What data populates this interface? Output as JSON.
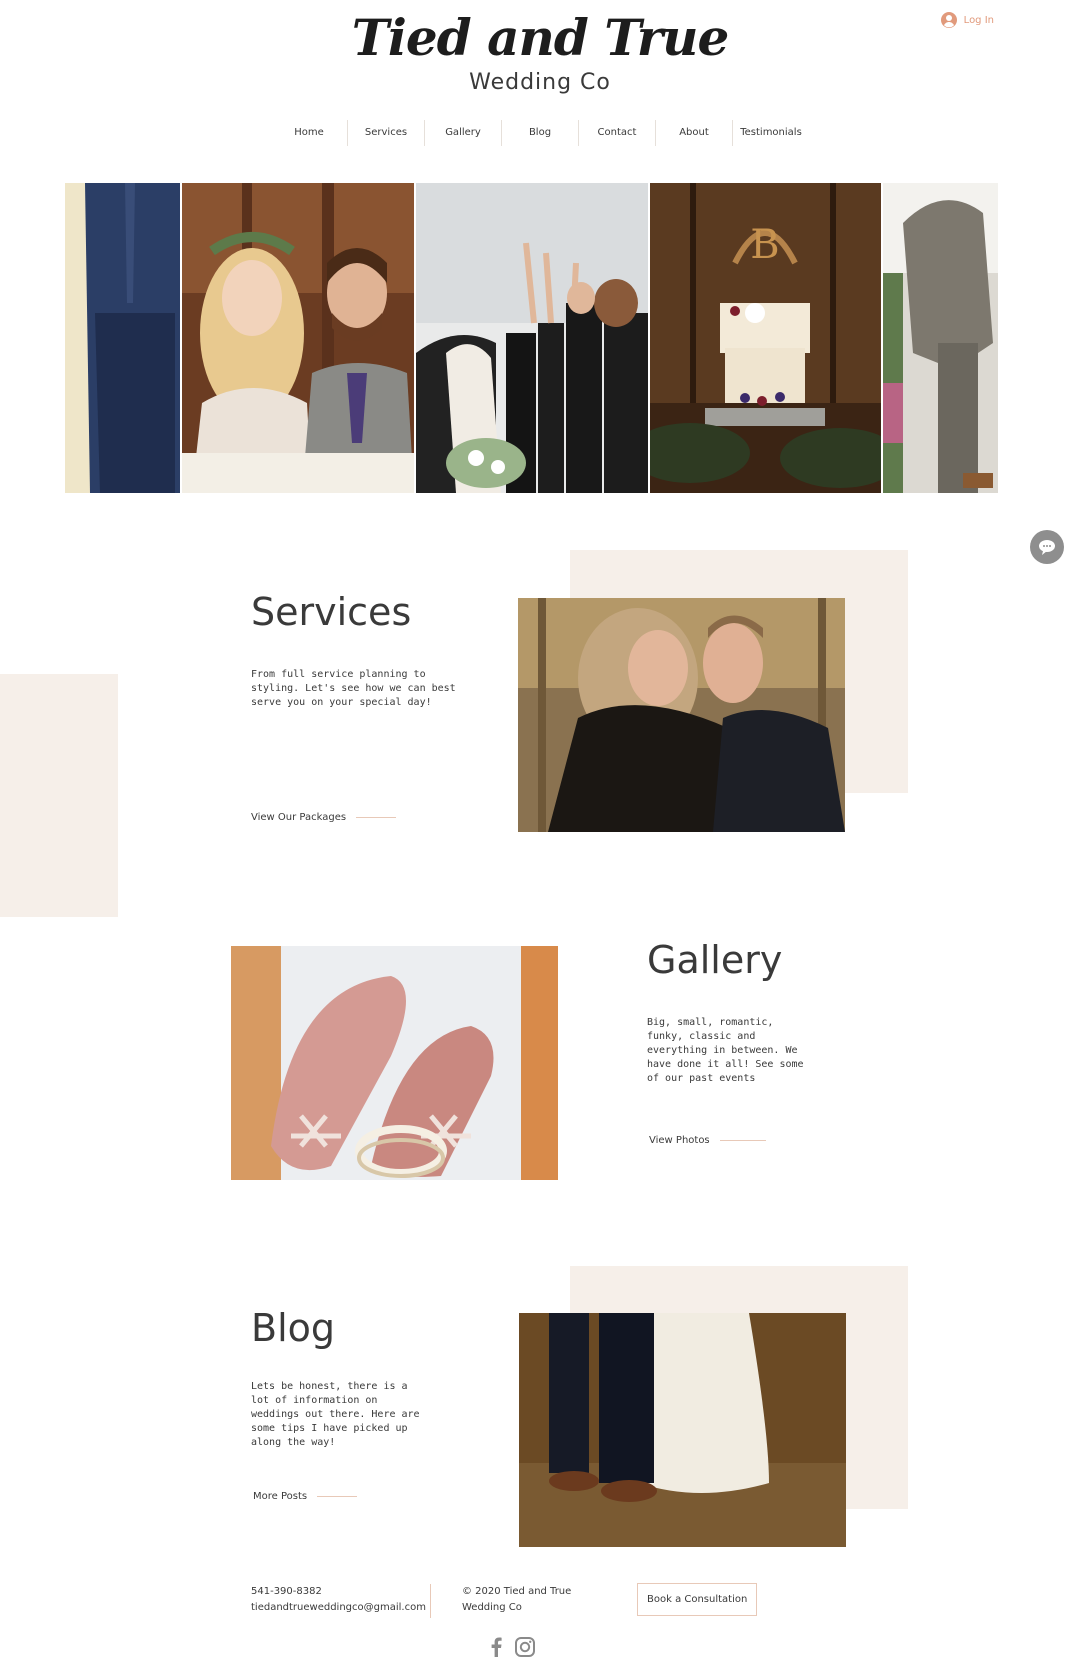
{
  "header": {
    "brand": "Tied and True",
    "subtitle": "Wedding Co",
    "login_label": "Log In"
  },
  "nav": {
    "items": [
      "Home",
      "Services",
      "Gallery",
      "Blog",
      "Contact",
      "About",
      "Testimonials"
    ]
  },
  "services": {
    "title": "Services",
    "text": "From full service planning to styling. Let's see how we can best serve you on your special day!",
    "link": "View Our Packages"
  },
  "gallery": {
    "title": "Gallery",
    "text": "Big, small, romantic, funky, classic and everything in between. We have done it all! See some of our past events",
    "link": "View Photos"
  },
  "blog": {
    "title": "Blog",
    "text": "Lets be honest, there is a lot of information on weddings out there. Here are some tips I have picked up along the way!",
    "link": "More Posts"
  },
  "footer": {
    "phone": "541-390-8382",
    "email": "tiedandtrueweddingco@gmail.com",
    "copyright": "© 2020 Tied and True Wedding Co",
    "cta": "Book a Consultation"
  },
  "colors": {
    "accent": "#e19a7c",
    "beige": "#f6efe9",
    "text": "#3a3a3a"
  },
  "icons": [
    "user-icon",
    "chat-icon",
    "facebook-icon",
    "instagram-icon"
  ]
}
